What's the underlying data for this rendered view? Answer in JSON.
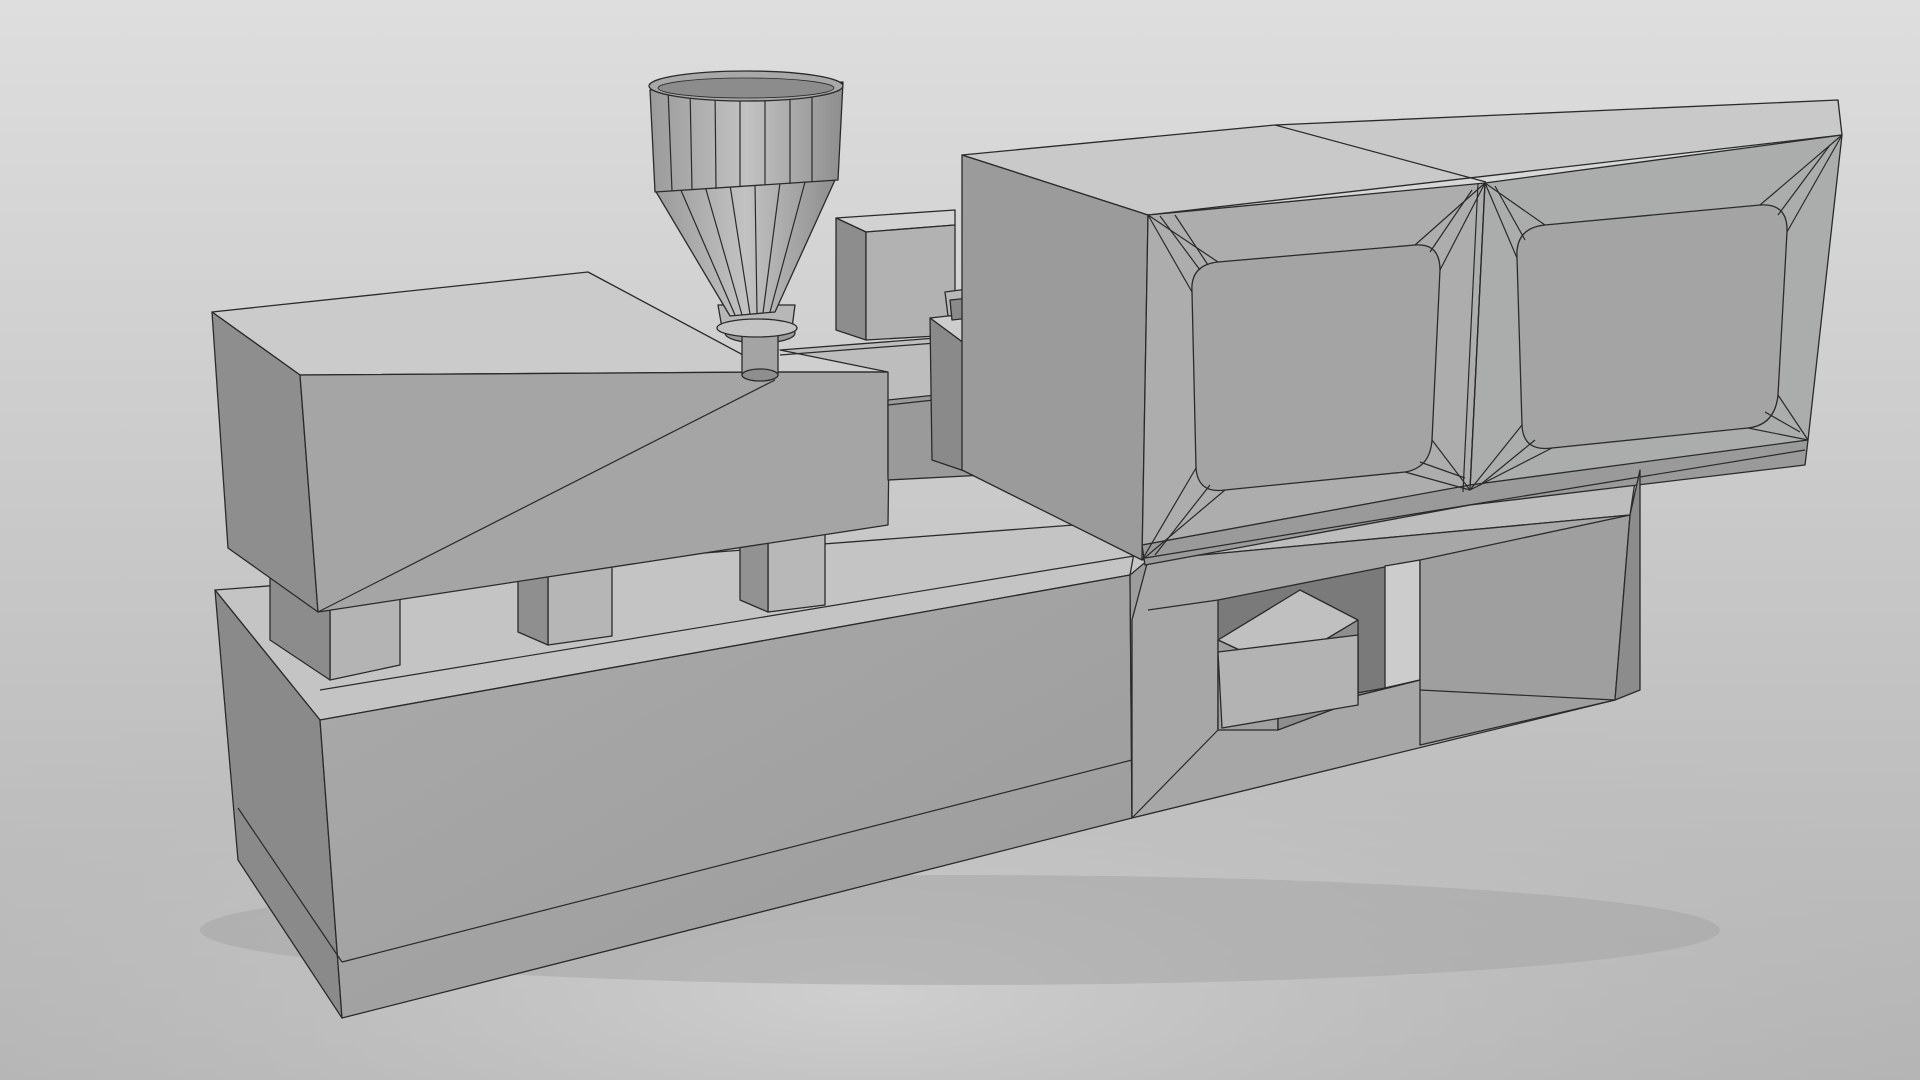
{
  "scene": {
    "subject": "injection-molding-machine",
    "render_style": "clay-wireframe",
    "colors": {
      "backdrop_top": "#dadada",
      "backdrop_bottom": "#b8b8b8",
      "face_light": "#c9c9c9",
      "face_mid": "#a9a9a9",
      "face_dark": "#8d8d8d",
      "face_shadow": "#6e6e6e",
      "wire": "#2a2a2a"
    },
    "parts": [
      "machine-base",
      "injection-unit",
      "hopper",
      "barrel",
      "nozzle-housing",
      "control-box",
      "clamping-unit",
      "safety-guard-windows",
      "storage-bin"
    ]
  }
}
